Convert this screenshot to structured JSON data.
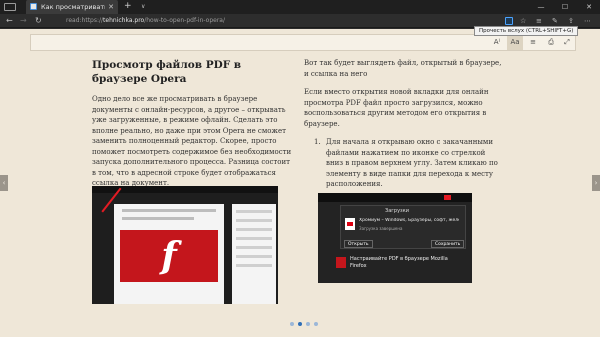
{
  "tab": {
    "title": "Как просматривать PD",
    "close": "✕",
    "new_tab": "+",
    "tab_list": "∨"
  },
  "window_controls": {
    "minimize": "—",
    "maximize": "☐",
    "close": "✕"
  },
  "navbar": {
    "back": "←",
    "forward": "→",
    "refresh": "↻",
    "url_prefix": "read:https://",
    "url_domain": "tehnichka.pro",
    "url_path": "/how-to-open-pdf-in-opera/",
    "favorite": "☆",
    "tooltip": "Прочесть вслух (CTRL+SHIFT+G)"
  },
  "reader_toolbar": {
    "read_aloud": "A⁾",
    "text_options": "Aa",
    "print": "⎙",
    "fullscreen": "⤢",
    "learning": "≡"
  },
  "side_arrows": {
    "left": "‹",
    "right": "›"
  },
  "article": {
    "heading": "Просмотр файлов PDF в браузере Opera",
    "para1": "Одно дело все же просматривать в браузере документы с онлайн-ресурсов, а другое – открывать уже загруженные, в режиме офлайн. Сделать это вполне реально, но даже при этом Opera не сможет заменить полноценный редактор. Скорее, просто поможет посмотреть содержимое без необходимости запуска дополнительного процесса. Разница состоит в том, что в адресной строке будет отображаться ссылка на документ.",
    "col2_intro": "Вот так будет выглядеть файл, открытый в браузере, и ссылка на него",
    "col2_para": "Если вместо открытия новой вкладки для онлайн просмотра PDF файл просто загрузился, можно воспользоваться другим методом его открытия в браузере.",
    "list_num": "1.",
    "list_item": "Для начала я открываю окно с закачанными файлами нажатием по иконке со стрелкой вниз в правом верхнем углу. Затем кликаю по элементу в виде папки для перехода к месту расположения."
  },
  "download_shot": {
    "panel_title": "Загрузки",
    "file_name": "Хромиум – Windows, Браузеры, софт, железо, реле...",
    "status": "Загрузка завершена",
    "btn_open": "Открыть",
    "btn_save": "Сохранить",
    "below_text": "Настраивайте PDF в браузере Mozilla Firefox"
  },
  "pagination": {
    "pages": 4,
    "current": 2
  },
  "colors": {
    "page_bg": "#efe7d8",
    "flash_red": "#c4161c",
    "active_dot": "#2f6fb7"
  }
}
